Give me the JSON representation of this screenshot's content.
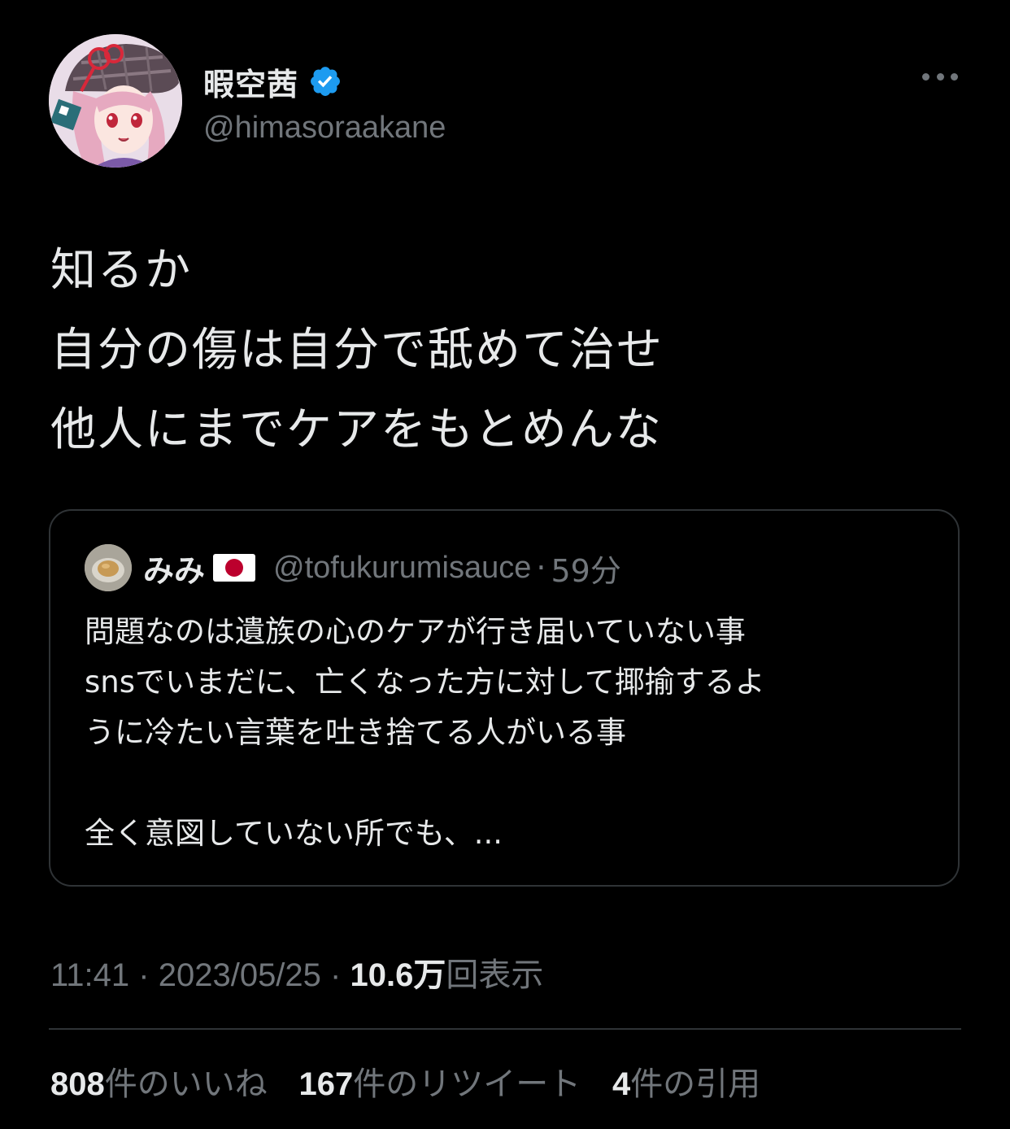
{
  "author": {
    "display_name": "暇空茜",
    "handle": "@himasoraakane",
    "verified": true,
    "avatar_icon": "anime-girl-avatar"
  },
  "tweet": {
    "lines": [
      "知るか",
      "自分の傷は自分で舐めて治せ",
      "他人にまでケアをもとめんな"
    ]
  },
  "quote": {
    "name": "みみ",
    "flag_icon": "japan-flag-icon",
    "handle": "@tofukurumisauce",
    "dot": "·",
    "time": "59分",
    "lines": [
      "問題なのは遺族の心のケアが行き届いていない事",
      "snsでいまだに、亡くなった方に対して揶揄するよ",
      "うに冷たい言葉を吐き捨てる人がいる事",
      "",
      "全く意図していない所でも、..."
    ]
  },
  "meta": {
    "time": "11:41",
    "sep1": "·",
    "date": "2023/05/25",
    "sep2": "·",
    "views_count": "10.6万",
    "views_label": "回表示"
  },
  "stats": {
    "likes_count": "808",
    "likes_label": "件のいいね",
    "retweets_count": "167",
    "retweets_label": "件のリツイート",
    "quotes_count": "4",
    "quotes_label": "件の引用"
  },
  "colors": {
    "background": "#000000",
    "text_primary": "#e7e9ea",
    "text_secondary": "#71767b",
    "border": "#2f3336",
    "verified_blue": "#1d9bf0"
  }
}
